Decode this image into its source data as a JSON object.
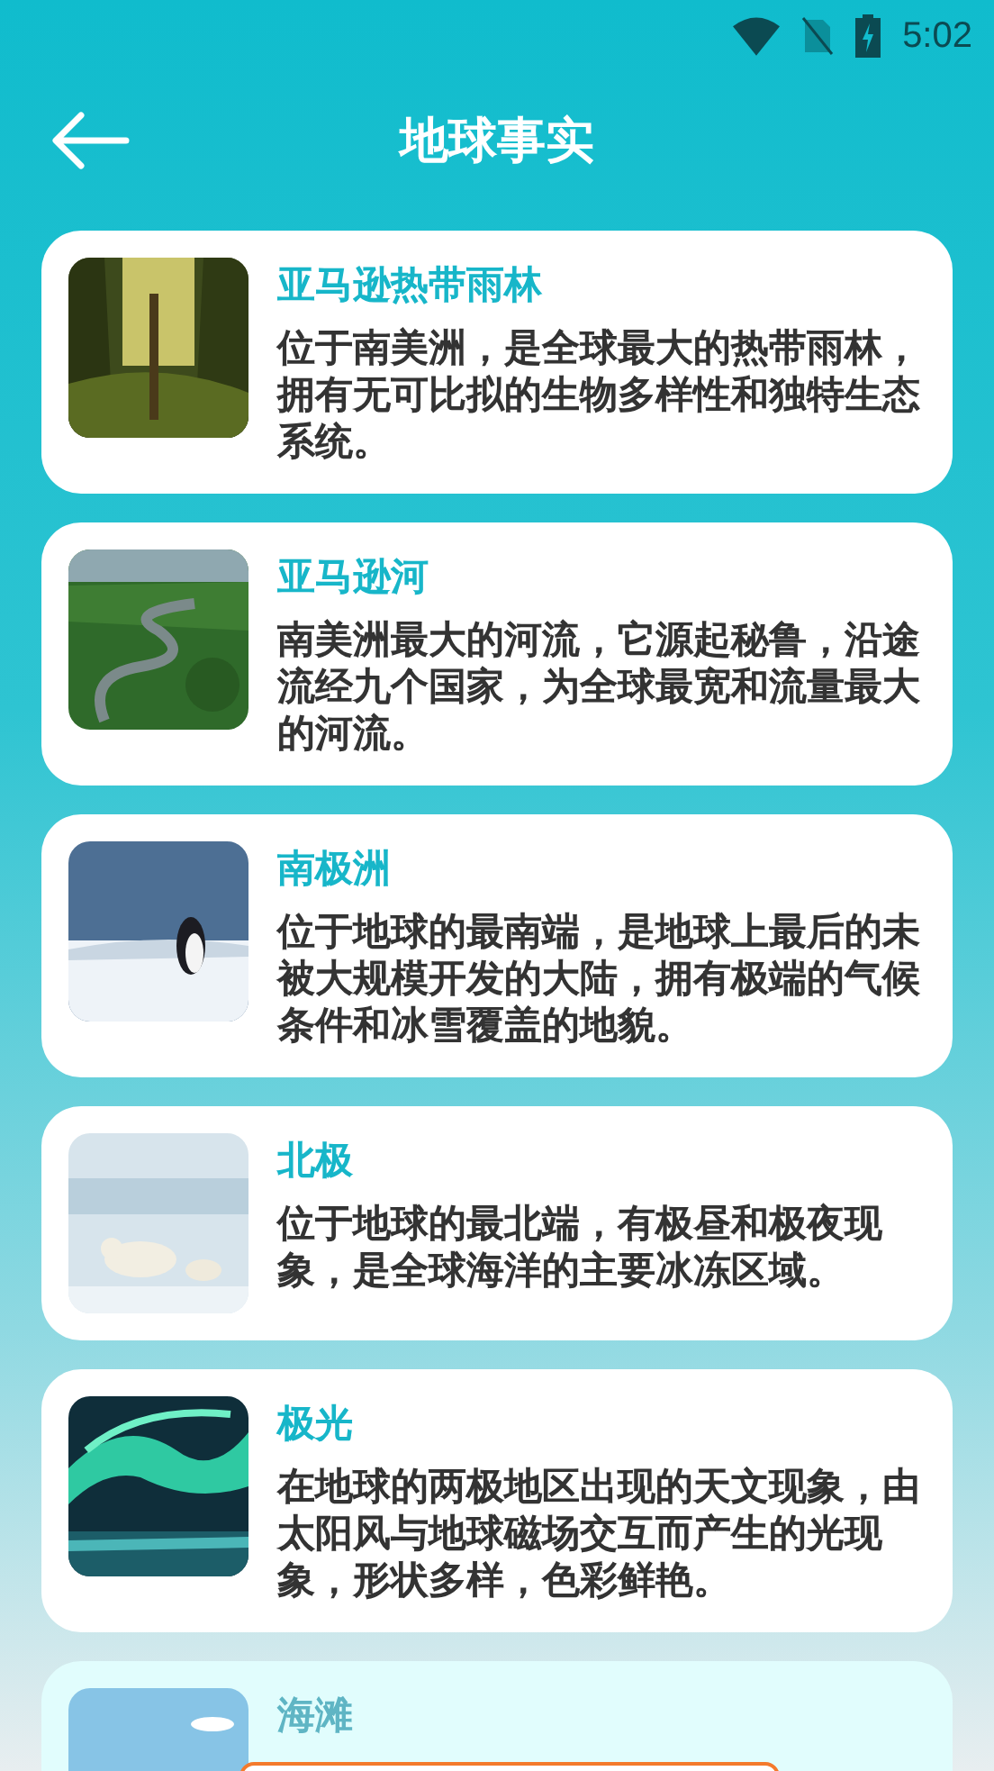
{
  "status_bar": {
    "time": "5:02"
  },
  "header": {
    "title": "地球事实"
  },
  "facts": [
    {
      "title": "亚马逊热带雨林",
      "text": "位于南美洲，是全球最大的热带雨林，拥有无可比拟的生物多样性和独特生态系统。",
      "faded": false
    },
    {
      "title": "亚马逊河",
      "text": "南美洲最大的河流，它源起秘鲁，沿途流经九个国家，为全球最宽和流量最大的河流。",
      "faded": false
    },
    {
      "title": "南极洲",
      "text": "位于地球的最南端，是地球上最后的未被大规模开发的大陆，拥有极端的气候条件和冰雪覆盖的地貌。",
      "faded": false
    },
    {
      "title": "北极",
      "text": "位于地球的最北端，有极昼和极夜现象，是全球海洋的主要冰冻区域。",
      "faded": false
    },
    {
      "title": "极光",
      "text": "在地球的两极地区出现的天文现象，由太阳风与地球磁场交互而产生的光现象，形状多样，色彩鲜艳。",
      "faded": false
    },
    {
      "title": "海滩",
      "faded": true
    }
  ]
}
